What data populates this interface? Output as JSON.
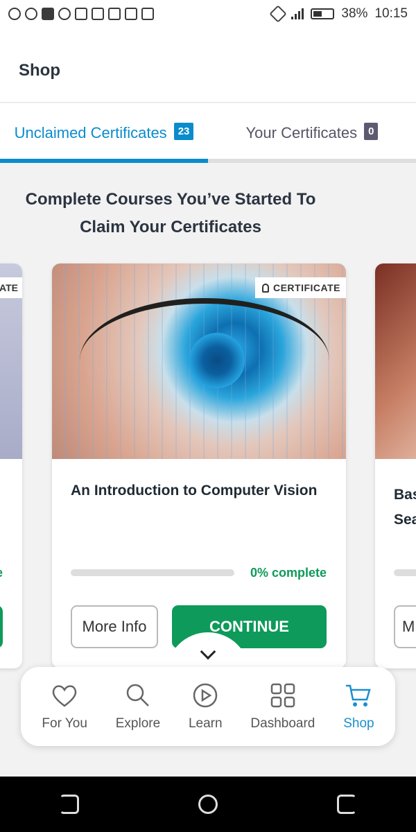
{
  "status_bar": {
    "battery": "38%",
    "time": "10:15"
  },
  "header": {
    "title": "Shop"
  },
  "tabs": [
    {
      "label": "Unclaimed Certificates",
      "count": "23"
    },
    {
      "label": "Your Certificates",
      "count": "0"
    }
  ],
  "section": {
    "heading_line1": "Complete Courses You’ve Started To",
    "heading_line2": "Claim Your Certificates"
  },
  "cards": {
    "left": {
      "badge": "ATE",
      "progress_label": "e"
    },
    "main": {
      "badge": "CERTIFICATE",
      "title": "An Introduction to Computer Vision",
      "progress": 0,
      "progress_label": "0% complete",
      "more_info": "More Info",
      "continue": "CONTINUE"
    },
    "right": {
      "title": "Bas\nSea",
      "more_info": "M"
    }
  },
  "bottom_nav": {
    "items": [
      {
        "label": "For You",
        "icon": "heart-icon"
      },
      {
        "label": "Explore",
        "icon": "search-icon"
      },
      {
        "label": "Learn",
        "icon": "play-circle-icon"
      },
      {
        "label": "Dashboard",
        "icon": "grid-icon"
      },
      {
        "label": "Shop",
        "icon": "cart-icon"
      }
    ],
    "active_index": 4
  },
  "colors": {
    "accent": "#0a8ccc",
    "success": "#0e9a5a",
    "nav_active": "#1a8fcf"
  }
}
